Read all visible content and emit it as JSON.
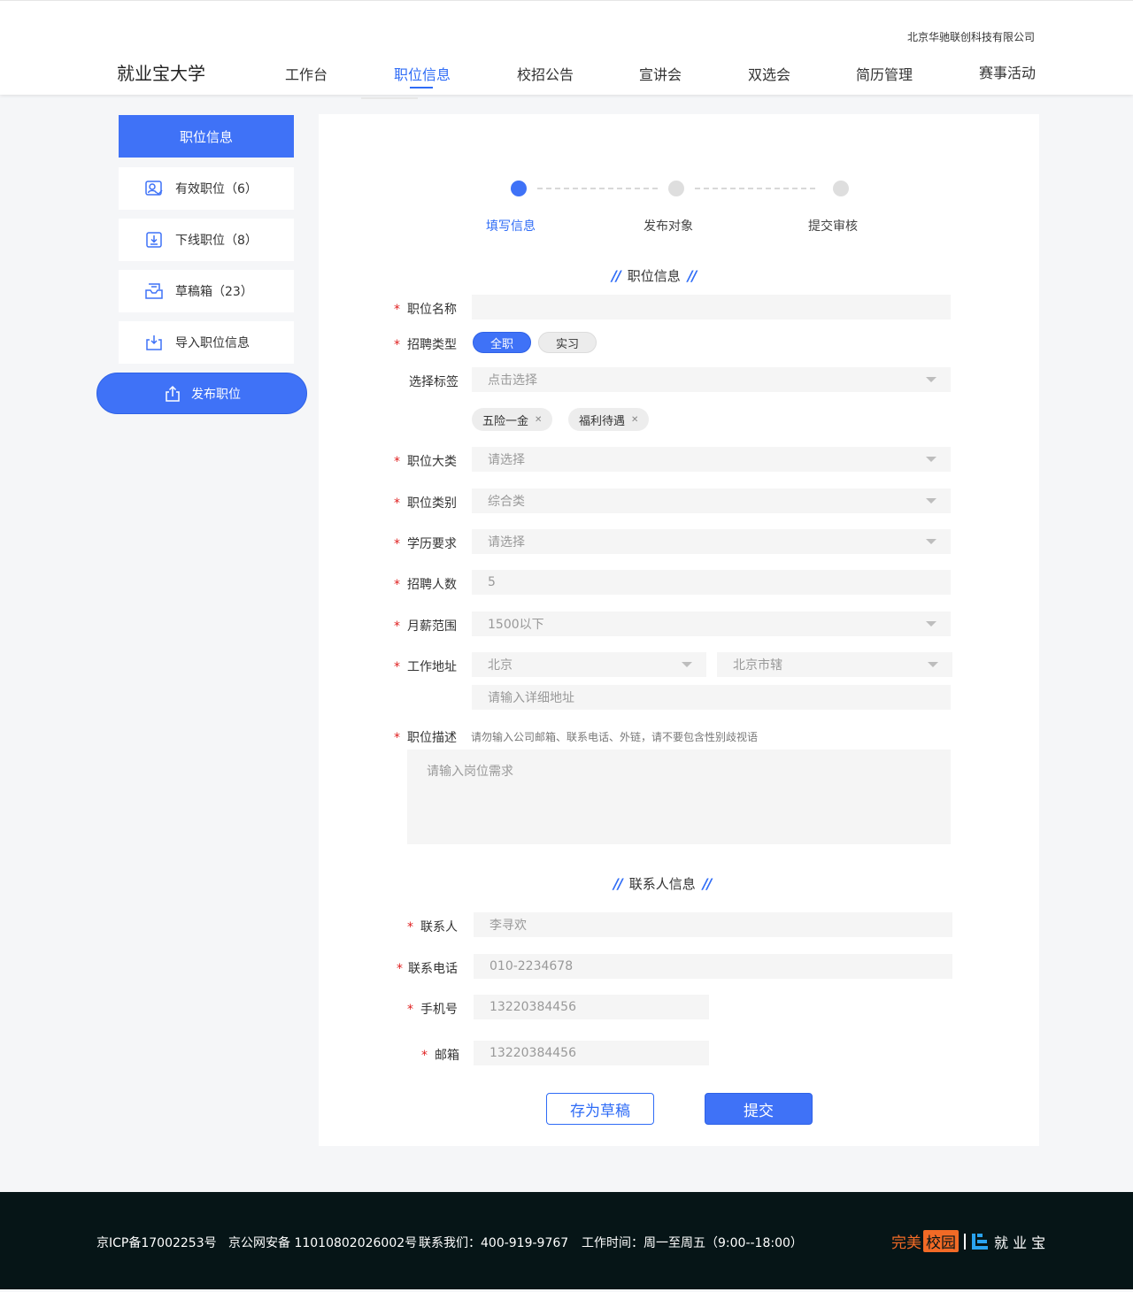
{
  "header": {
    "company": "北京华驰联创科技有限公司",
    "brand": "就业宝大学",
    "nav": [
      "工作台",
      "职位信息",
      "校招公告",
      "宣讲会",
      "双选会",
      "简历管理",
      "赛事活动"
    ],
    "active_nav": "职位信息"
  },
  "sidebar": {
    "title": "职位信息",
    "items": [
      {
        "label": "有效职位（6）",
        "icon": "user-check-icon"
      },
      {
        "label": "下线职位（8）",
        "icon": "download-icon"
      },
      {
        "label": "草稿箱（23）",
        "icon": "inbox-icon"
      },
      {
        "label": "导入职位信息",
        "icon": "import-icon"
      }
    ],
    "publish_label": "发布职位",
    "publish_icon": "upload-icon"
  },
  "steps": {
    "items": [
      "填写信息",
      "发布对象",
      "提交审核"
    ],
    "current": 0
  },
  "job_section": {
    "title": "职位信息",
    "name_label": "职位名称",
    "type_label": "招聘类型",
    "type_options": [
      "全职",
      "实习"
    ],
    "type_selected": "全职",
    "tags_label": "选择标签",
    "tags_placeholder": "点击选择",
    "tags": [
      "五险一金",
      "福利待遇"
    ],
    "category_label": "职位大类",
    "category_value": "请选择",
    "kind_label": "职位类别",
    "kind_value": "综合类",
    "edu_label": "学历要求",
    "edu_value": "请选择",
    "count_label": "招聘人数",
    "count_value": "5",
    "salary_label": "月薪范围",
    "salary_value": "1500以下",
    "address_label": "工作地址",
    "city_value": "北京",
    "district_value": "北京市辖",
    "address_placeholder": "请输入详细地址",
    "desc_label": "职位描述",
    "desc_hint": "请勿输入公司邮箱、联系电话、外链，请不要包含性别歧视语",
    "desc_placeholder": "请输入岗位需求"
  },
  "contact_section": {
    "title": "联系人信息",
    "contact_label": "联系人",
    "contact_value": "李寻欢",
    "phone_label": "联系电话",
    "phone_value": "010-2234678",
    "mobile_label": "手机号",
    "mobile_value": "13220384456",
    "email_label": "邮箱",
    "email_value": "13220384456"
  },
  "actions": {
    "draft": "存为草稿",
    "submit": "提交"
  },
  "footer": {
    "icp": "京ICP备17002253号",
    "police": "京公网安备 11010802026002号",
    "contact": "联系我们：400-919-9767",
    "hours": "工作时间：周一至周五（9:00--18:00）",
    "logo1_a": "完美",
    "logo1_b": "校园",
    "logo2": "就 业 宝"
  },
  "colors": {
    "primary": "#3f72f7",
    "required": "#e02020",
    "footer_bg": "#061517",
    "logo_orange": "#f26a26"
  }
}
